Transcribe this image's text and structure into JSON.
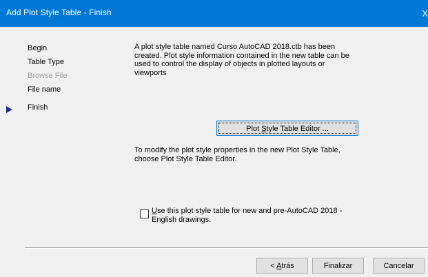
{
  "window": {
    "title": "Add Plot Style Table - Finish",
    "close_glyph": "X"
  },
  "steps": [
    {
      "label": "Begin",
      "state": "normal"
    },
    {
      "label": "Table Type",
      "state": "normal"
    },
    {
      "label": "Browse File",
      "state": "disabled"
    },
    {
      "label": "File name",
      "state": "normal"
    },
    {
      "label": "Finish",
      "state": "current"
    }
  ],
  "content": {
    "message": "A plot style table named Curso AutoCAD 2018.ctb has been\ncreated. Plot style information contained in the new table can be\nused to control the display of objects in plotted layouts or\nviewports",
    "editor_button": {
      "before": "Plot ",
      "accel": "S",
      "after": "tyle Table Editor ..."
    },
    "modify_message": "To modify the plot style properties in the new Plot Style Table,\nchoose Plot Style Table Editor.",
    "checkbox": {
      "checked": false,
      "accel": "U",
      "rest": "se this plot style table for new and pre-AutoCAD 2018 -\nEnglish drawings."
    }
  },
  "footer": {
    "back": {
      "before": "< ",
      "accel": "A",
      "after": "trás"
    },
    "finish_label": "Finalizar",
    "cancel_label": "Cancelar"
  },
  "colors": {
    "titlebar": "#0078d7",
    "current_step_arrow": "#1e2f86",
    "disabled_text": "#a0a0a0",
    "background": "#f0f0f0"
  },
  "icons": {
    "current_step": "right-triangle",
    "close": "close-x"
  }
}
